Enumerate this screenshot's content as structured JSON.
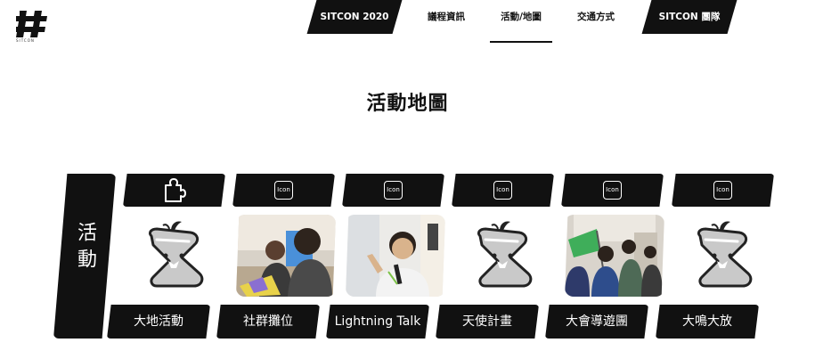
{
  "header": {
    "logo_label": "SITCON",
    "logo_sub": "SITCON"
  },
  "nav": {
    "items": [
      {
        "label": "SITCON 2020",
        "style": "dark"
      },
      {
        "label": "議程資訊",
        "style": "plain"
      },
      {
        "label": "活動/地圖",
        "style": "plain",
        "active": true
      },
      {
        "label": "交通方式",
        "style": "plain"
      },
      {
        "label": "SITCON 團隊",
        "style": "dark"
      }
    ]
  },
  "page_title": "活動地圖",
  "board": {
    "side_label": "活動",
    "icon_text": "Icon",
    "items": [
      {
        "label": "大地活動",
        "icon": "puzzle-icon",
        "image": "mascot"
      },
      {
        "label": "社群攤位",
        "icon": "placeholder-icon",
        "image": "photo-booth"
      },
      {
        "label": "Lightning Talk",
        "icon": "placeholder-icon",
        "image": "photo-speaker"
      },
      {
        "label": "天使計畫",
        "icon": "placeholder-icon",
        "image": "mascot"
      },
      {
        "label": "大會導遊團",
        "icon": "placeholder-icon",
        "image": "photo-tour"
      },
      {
        "label": "大鳴大放",
        "icon": "placeholder-icon",
        "image": "mascot"
      }
    ]
  },
  "colors": {
    "dark": "#111111",
    "background": "#ffffff",
    "mascot_gray": "#c9c9c9",
    "mascot_leaf": "#222222"
  }
}
